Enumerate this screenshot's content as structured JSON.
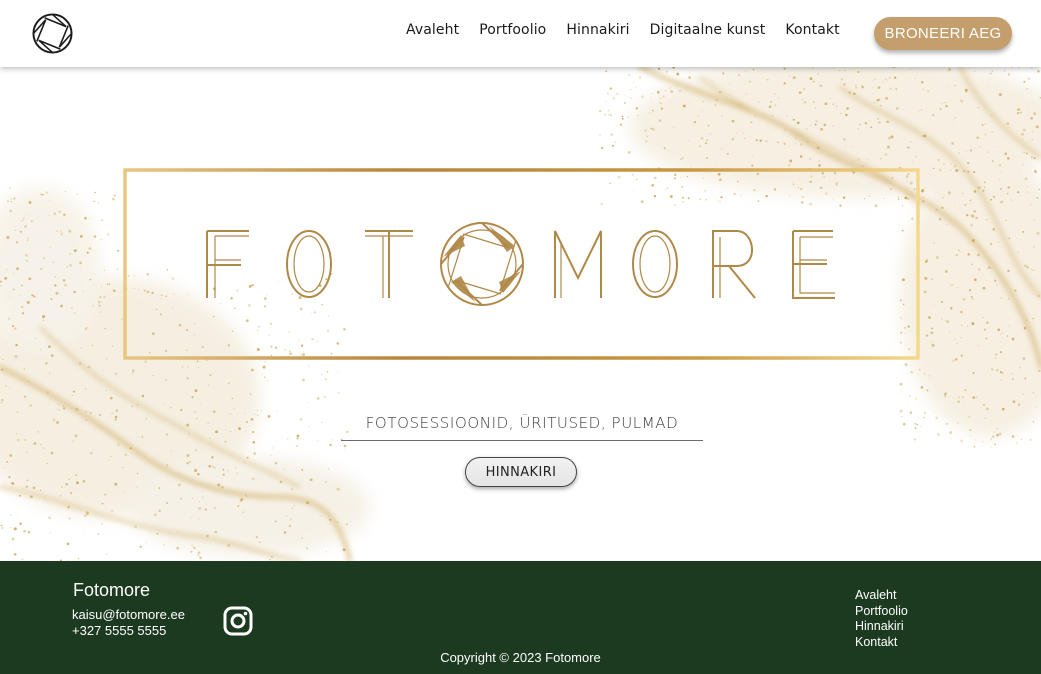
{
  "header": {
    "logo_icon": "camera-aperture-icon",
    "nav": [
      "Avaleht",
      "Portfoolio",
      "Hinnakiri",
      "Digitaalne kunst",
      "Kontakt"
    ],
    "book_button": "BRONEERI AEG"
  },
  "hero": {
    "brand_letters": [
      "F",
      "O",
      "T",
      "M",
      "O",
      "R",
      "E"
    ],
    "tagline": "FOTOSESSIOONID, ÜRITUSED, PULMAD",
    "price_button": "HINNAKIRI",
    "colors": {
      "gold": "#b88a4a",
      "gold_light": "#e7c88c"
    }
  },
  "footer": {
    "brand": "Fotomore",
    "email": "kaisu@fotomore.ee",
    "phone": "+327 5555 5555",
    "social_icon": "instagram-icon",
    "links": [
      "Avaleht",
      "Portfoolio",
      "Hinnakiri",
      "Kontakt"
    ],
    "copyright": "Copyright © 2023 Fotomore",
    "background": "#1c3a20"
  }
}
